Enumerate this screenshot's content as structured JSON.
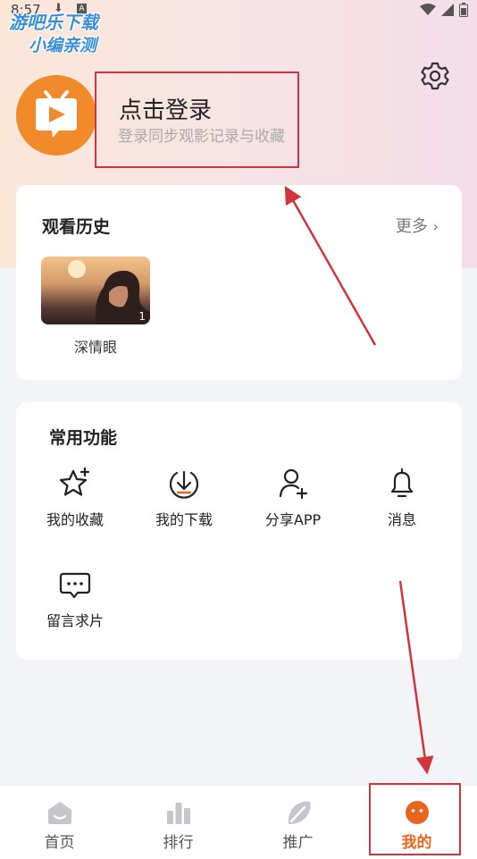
{
  "status_bar": {
    "time": "8:57"
  },
  "watermark": {
    "line1": "游吧乐下载",
    "line2": "小编亲测"
  },
  "profile": {
    "login_title": "点击登录",
    "login_subtitle": "登录同步观影记录与收藏"
  },
  "history": {
    "title": "观看历史",
    "more_label": "更多",
    "items": [
      {
        "title": "深情眼",
        "episode": "1"
      }
    ]
  },
  "functions": {
    "title": "常用功能",
    "items": [
      {
        "label": "我的收藏",
        "icon": "star-icon"
      },
      {
        "label": "我的下载",
        "icon": "download-icon"
      },
      {
        "label": "分享APP",
        "icon": "share-user-icon"
      },
      {
        "label": "消息",
        "icon": "bell-icon"
      },
      {
        "label": "留言求片",
        "icon": "message-icon"
      }
    ]
  },
  "tabbar": {
    "items": [
      {
        "label": "首页",
        "icon": "home-icon"
      },
      {
        "label": "排行",
        "icon": "ranking-icon"
      },
      {
        "label": "推广",
        "icon": "promote-icon"
      },
      {
        "label": "我的",
        "icon": "profile-icon",
        "active": true
      }
    ]
  },
  "colors": {
    "accent": "#e8651e",
    "annotation": "#d0343c",
    "avatar": "#f08a2a"
  }
}
